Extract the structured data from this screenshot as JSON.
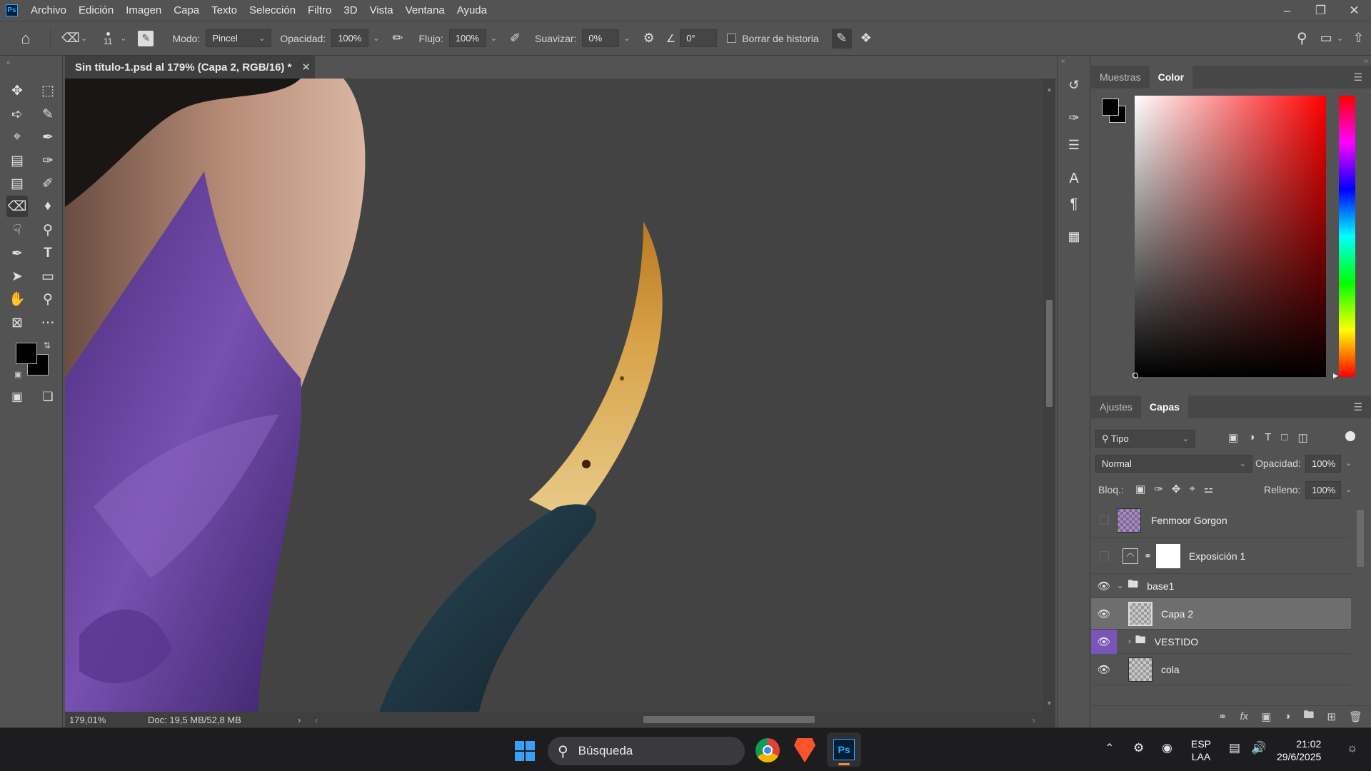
{
  "app": {
    "logo": "Ps",
    "menu": [
      "Archivo",
      "Edición",
      "Imagen",
      "Capa",
      "Texto",
      "Selección",
      "Filtro",
      "3D",
      "Vista",
      "Ventana",
      "Ayuda"
    ]
  },
  "options_bar": {
    "brush_size": "11",
    "mode_label": "Modo:",
    "mode_value": "Pincel",
    "opacity_label": "Opacidad:",
    "opacity_value": "100%",
    "flow_label": "Flujo:",
    "flow_value": "100%",
    "smooth_label": "Suavizar:",
    "smooth_value": "0%",
    "angle_value": "0°",
    "erase_history_label": "Borrar de historia"
  },
  "document": {
    "tab_title": "Sin título-1.psd al 179% (Capa 2, RGB/16) *",
    "zoom": "179,01%",
    "doc_info": "Doc: 19,5 MB/52,8 MB"
  },
  "color_panel": {
    "tabs": [
      "Muestras",
      "Color"
    ],
    "active_tab": "Color",
    "foreground": "#000000",
    "background": "#000000",
    "hue_color": "#ff0000"
  },
  "layers_panel": {
    "tabs": [
      "Ajustes",
      "Capas"
    ],
    "active_tab": "Capas",
    "filter_label": "Tipo",
    "blend_mode": "Normal",
    "opacity_label": "Opacidad:",
    "opacity_value": "100%",
    "lock_label": "Bloq.:",
    "fill_label": "Relleno:",
    "fill_value": "100%",
    "layers": [
      {
        "name": "Fenmoor Gorgon",
        "visible": false,
        "type": "smart-object"
      },
      {
        "name": "Exposición 1",
        "visible": false,
        "type": "adjustment"
      },
      {
        "name": "base1",
        "visible": true,
        "type": "group"
      },
      {
        "name": "Capa 2",
        "visible": true,
        "type": "pixel",
        "selected": true
      },
      {
        "name": "VESTIDO",
        "visible": true,
        "type": "group"
      },
      {
        "name": "cola",
        "visible": true,
        "type": "pixel"
      }
    ]
  },
  "taskbar": {
    "search_placeholder": "Búsqueda",
    "language": "ESP",
    "language_sub": "LAA",
    "time": "21:02",
    "date": "29/6/2025"
  }
}
